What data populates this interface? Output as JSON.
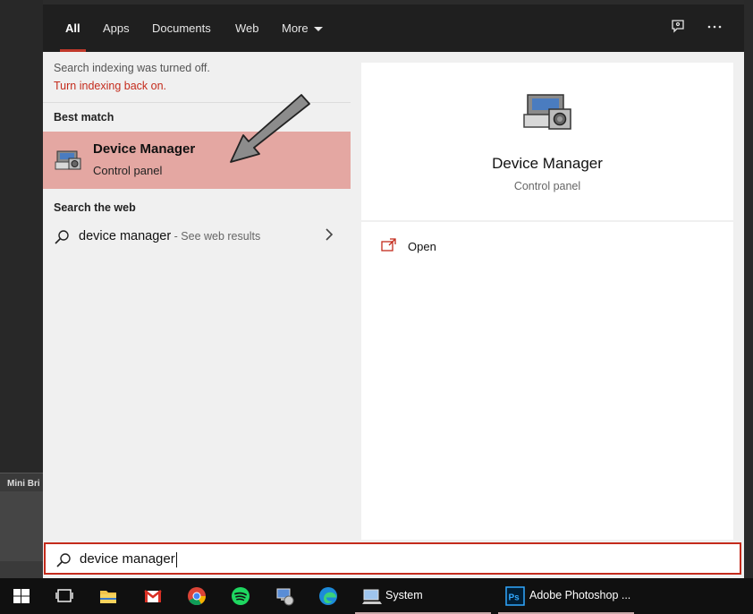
{
  "tabs": [
    {
      "label": "All",
      "active": true
    },
    {
      "label": "Apps"
    },
    {
      "label": "Documents"
    },
    {
      "label": "Web"
    },
    {
      "label": "More"
    }
  ],
  "background": {
    "mini_label": "Mini Bri"
  },
  "notices": {
    "indexing_off": "Search indexing was turned off.",
    "turn_on_link": "Turn indexing back on."
  },
  "sections": {
    "best_match": "Best match",
    "search_web": "Search the web"
  },
  "best_match": {
    "title": "Device Manager",
    "subtitle": "Control panel",
    "icon": "device-manager-icon"
  },
  "web_result": {
    "query": "device manager",
    "hint": " - See web results"
  },
  "preview": {
    "title": "Device Manager",
    "subtitle": "Control panel",
    "actions": [
      {
        "label": "Open",
        "icon": "open-icon"
      }
    ]
  },
  "search": {
    "value": "device manager"
  },
  "taskbar": {
    "icons": [
      "windows-start-icon",
      "task-view-icon",
      "file-explorer-icon",
      "gmail-icon",
      "chrome-icon",
      "spotify-icon",
      "network-icon",
      "edge-icon"
    ],
    "apps": [
      {
        "label": "System"
      },
      {
        "label": "Adobe Photoshop ..."
      }
    ]
  },
  "colors": {
    "accent": "#c42b1c",
    "highlight": "#e4a7a2",
    "topbar": "#1f1f1f",
    "taskbar": "#101010"
  }
}
